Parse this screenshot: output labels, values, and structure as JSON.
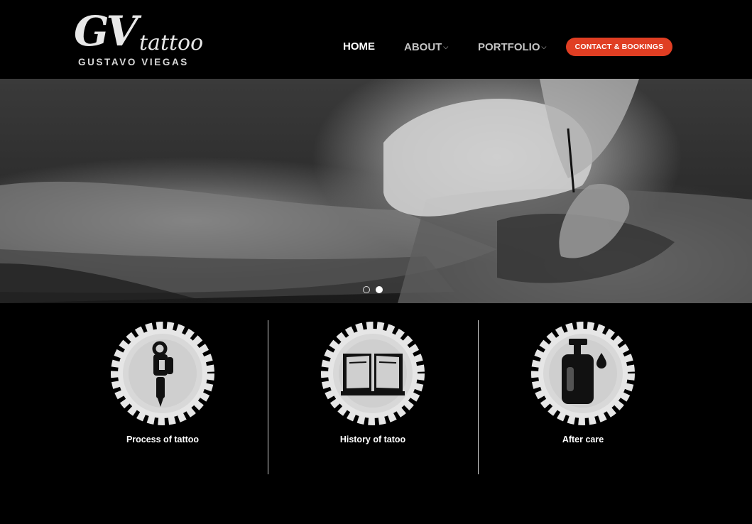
{
  "logo": {
    "brand": "GV",
    "script": "tattoo",
    "subtitle": "GUSTAVO VIEGAS"
  },
  "nav": {
    "items": [
      {
        "label": "HOME",
        "active": true
      },
      {
        "label": "ABOUT",
        "has_dropdown": true
      },
      {
        "label": "PORTFOLIO",
        "has_dropdown": true
      }
    ],
    "cta_label": "CONTACT & BOOKINGS"
  },
  "hero": {
    "slide_count": 2,
    "active_slide": 2
  },
  "features": [
    {
      "label": "Process of tattoo",
      "icon": "tattoo-machine-icon"
    },
    {
      "label": "History of tatoo",
      "icon": "book-icon"
    },
    {
      "label": "After care",
      "icon": "lotion-bottle-icon"
    }
  ],
  "colors": {
    "accent": "#e03e23",
    "background": "#000000",
    "badge_fill": "#e6e6e6",
    "icon_color": "#111111"
  }
}
